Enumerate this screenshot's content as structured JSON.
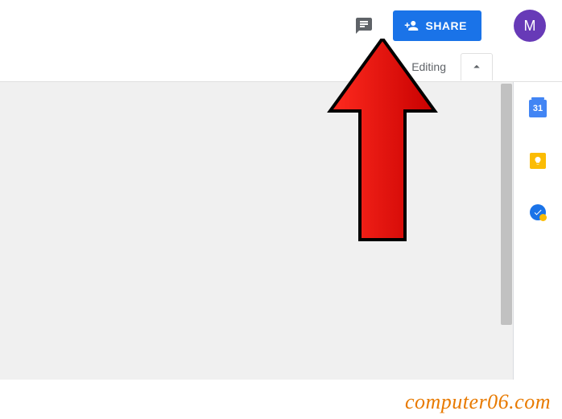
{
  "header": {
    "share_label": "SHARE",
    "avatar_letter": "M"
  },
  "toolbar": {
    "mode_label": "Editing"
  },
  "side_panel": {
    "calendar_day": "31"
  },
  "watermark": "computer06.com"
}
